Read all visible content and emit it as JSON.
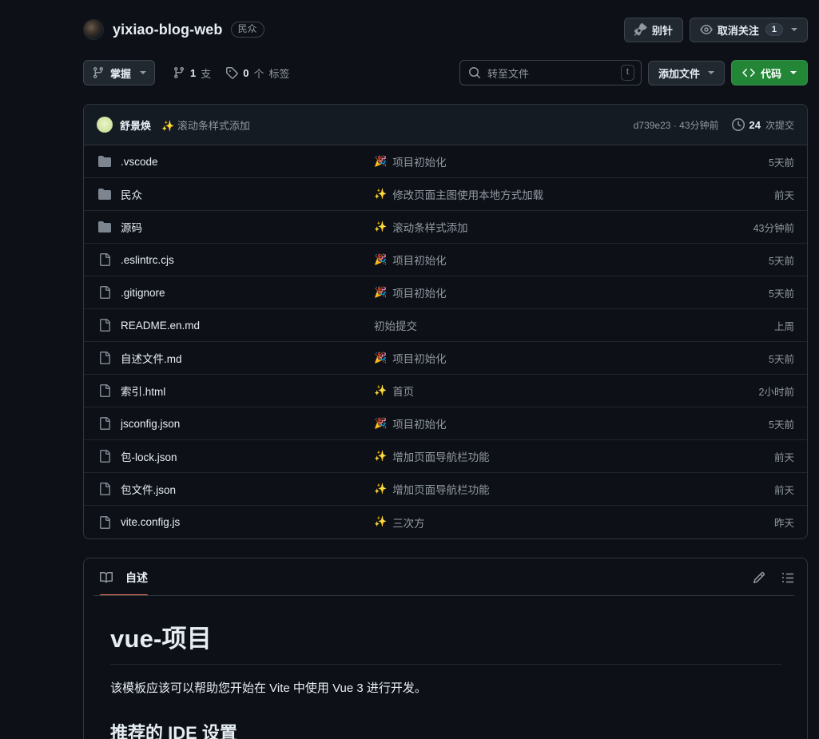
{
  "header": {
    "owner_avatar": "owner-avatar",
    "repo_name": "yixiao-blog-web",
    "visibility": "民众",
    "pin_label": "别针",
    "watch_label": "取消关注",
    "watch_count": "1"
  },
  "toolbar": {
    "branch_label": "掌握",
    "branch_count": "1",
    "branch_word": "支",
    "tag_count": "0",
    "tag_unit": "个",
    "tag_word": "标签",
    "search_placeholder": "转至文件",
    "search_key_hint": "t",
    "add_file_label": "添加文件",
    "code_label": "代码",
    "code_color": "#238636"
  },
  "commit_bar": {
    "author": "舒景焕",
    "message_emoji": "✨",
    "message": "滚动条样式添加",
    "hash": "d739e23",
    "hash_sep": "·",
    "time": "43分钟前",
    "commits_count": "24",
    "commits_label": "次提交"
  },
  "files": [
    {
      "name": ".vscode",
      "type": "dir",
      "emoji": "🎉",
      "message": "项目初始化",
      "time": "5天前"
    },
    {
      "name": "民众",
      "type": "dir",
      "emoji": "✨",
      "message": "修改页面主图使用本地方式加载",
      "time": "前天"
    },
    {
      "name": "源码",
      "type": "dir",
      "emoji": "✨",
      "message": "滚动条样式添加",
      "time": "43分钟前"
    },
    {
      "name": ".eslintrc.cjs",
      "type": "file",
      "emoji": "🎉",
      "message": "项目初始化",
      "time": "5天前"
    },
    {
      "name": ".gitignore",
      "type": "file",
      "emoji": "🎉",
      "message": "项目初始化",
      "time": "5天前"
    },
    {
      "name": "README.en.md",
      "type": "file",
      "emoji": "",
      "message": "初始提交",
      "time": "上周"
    },
    {
      "name": "自述文件.md",
      "type": "file",
      "emoji": "🎉",
      "message": "项目初始化",
      "time": "5天前"
    },
    {
      "name": "索引.html",
      "type": "file",
      "emoji": "✨",
      "message": "首页",
      "time": "2小时前"
    },
    {
      "name": "jsconfig.json",
      "type": "file",
      "emoji": "🎉",
      "message": "项目初始化",
      "time": "5天前"
    },
    {
      "name": "包-lock.json",
      "type": "file",
      "emoji": "✨",
      "message": "增加页面导航栏功能",
      "time": "前天"
    },
    {
      "name": "包文件.json",
      "type": "file",
      "emoji": "✨",
      "message": "增加页面导航栏功能",
      "time": "前天"
    },
    {
      "name": "vite.config.js",
      "type": "file",
      "emoji": "✨",
      "message": "三次方",
      "time": "昨天"
    }
  ],
  "readme": {
    "tab_label": "自述",
    "tab_accent": "#f78166",
    "heading": "vue-项目",
    "paragraph": "该模板应该可以帮助您开始在 Vite 中使用 Vue 3 进行开发。",
    "subheading": "推荐的 IDE 设置"
  }
}
